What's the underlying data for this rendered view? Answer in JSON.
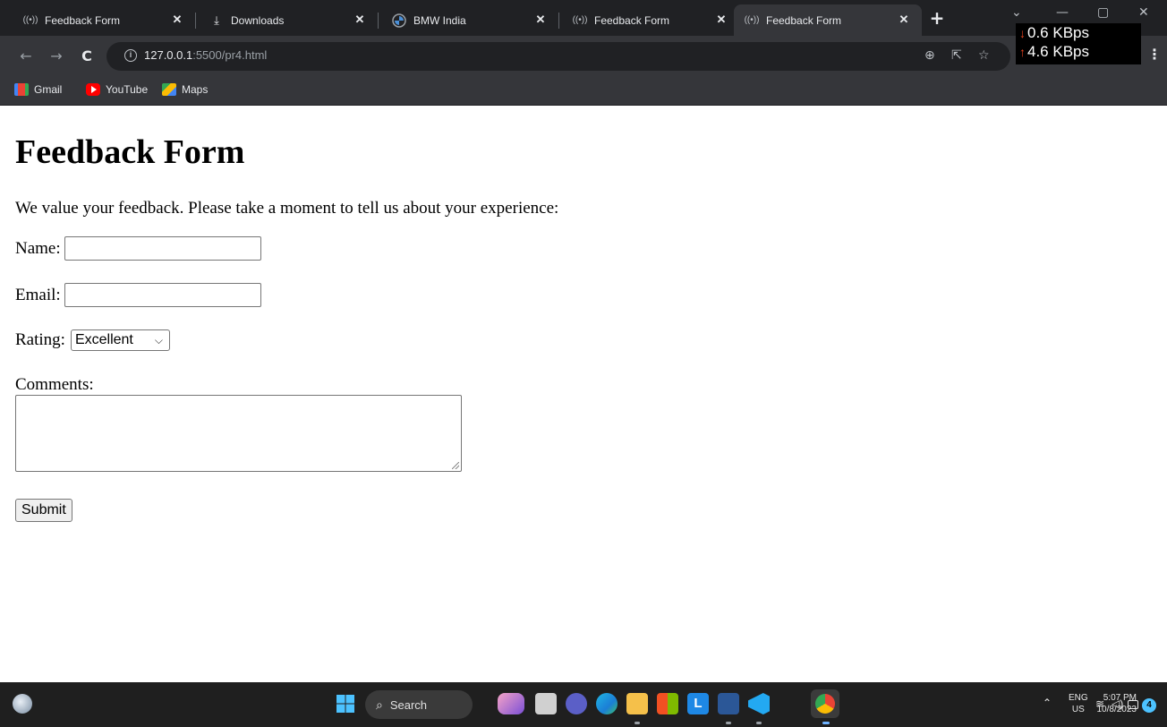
{
  "browser": {
    "tabs": [
      {
        "title": "Feedback Form",
        "icon": "radio-waves-icon",
        "active": false
      },
      {
        "title": "Downloads",
        "icon": "download-icon",
        "active": false
      },
      {
        "title": "BMW India",
        "icon": "bmw-logo-icon",
        "active": false
      },
      {
        "title": "Feedback Form",
        "icon": "radio-waves-icon",
        "active": false
      },
      {
        "title": "Feedback Form",
        "icon": "radio-waves-icon",
        "active": true
      }
    ],
    "address": {
      "host": "127.0.0.1",
      "path": ":5500/pr4.html"
    },
    "bookmarks": [
      {
        "label": "Gmail",
        "icon": "gmail-icon",
        "color": "#ea4335"
      },
      {
        "label": "YouTube",
        "icon": "youtube-icon",
        "color": "#ff0000"
      },
      {
        "label": "Maps",
        "icon": "maps-icon",
        "color": "#34a853"
      }
    ],
    "netmeter": {
      "down": "0.6 KBps",
      "up": "4.6 KBps"
    }
  },
  "page": {
    "heading": "Feedback Form",
    "intro": "We value your feedback. Please take a moment to tell us about your experience:",
    "fields": {
      "name_label": "Name:",
      "name_value": "",
      "email_label": "Email:",
      "email_value": "",
      "rating_label": "Rating:",
      "rating_selected": "Excellent",
      "comments_label": "Comments:",
      "comments_value": ""
    },
    "submit_label": "Submit"
  },
  "taskbar": {
    "search_label": "Search",
    "language": "ENG",
    "region": "US",
    "time": "5:07 PM",
    "date": "10/8/2023",
    "notification_count": "4"
  }
}
